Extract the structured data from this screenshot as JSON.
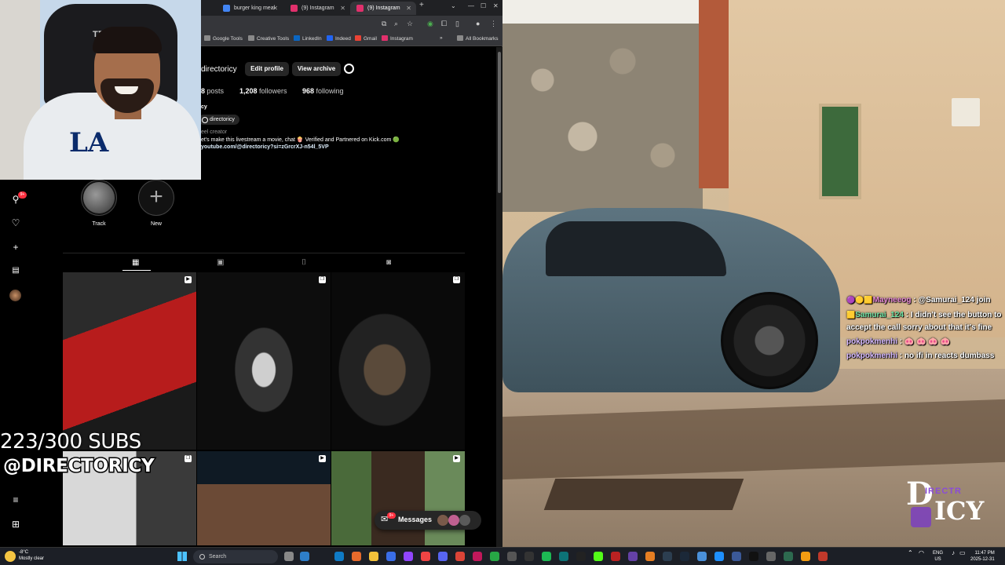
{
  "browser": {
    "tabs": [
      {
        "label": "burger king meal",
        "color": "#4285f4",
        "active": false
      },
      {
        "label": "(9) Instagram",
        "color": "#e1306c",
        "active": false
      },
      {
        "label": "(9) Instagram",
        "color": "#e1306c",
        "active": true
      }
    ],
    "new_tab": "+",
    "bookmarks": [
      {
        "label": "Google Tools",
        "color": "#f4b400"
      },
      {
        "label": "Creative Tools",
        "color": "#f4b400"
      },
      {
        "label": "LinkedIn",
        "color": "#0a66c2"
      },
      {
        "label": "Indeed",
        "color": "#2164f3"
      },
      {
        "label": "Gmail",
        "color": "#ea4335"
      },
      {
        "label": "Instagram",
        "color": "#e1306c"
      }
    ],
    "all_bookmarks": "All Bookmarks"
  },
  "profile": {
    "username": "directoricy",
    "edit_profile": "Edit profile",
    "view_archive": "View archive",
    "posts_count": "8",
    "posts_label": "posts",
    "followers_count": "1,208",
    "followers_label": "followers",
    "following_count": "968",
    "following_label": "following",
    "name_initial": "cy",
    "threads_handle": "directoricy",
    "category": "eel creator",
    "bio_line": "et's make this livestream a movie, chat 🍿 Verified and Partnered on Kick.com 🟢",
    "link": "youtube.com/@directoricy?si=zGrcrXJ-n54l_5VP"
  },
  "highlights": [
    {
      "label": "Track"
    },
    {
      "label": "New"
    }
  ],
  "left_nav": {
    "notif_badge": "9+"
  },
  "messages": {
    "label": "Messages",
    "badge": "9+"
  },
  "overlay": {
    "subs": "223/300 SUBS",
    "handle": "@DIRECTORICY"
  },
  "chat": [
    {
      "user": "Mayneeog",
      "text": ": @Samurai_124 join",
      "cls": "u1"
    },
    {
      "user": "Samurai_124",
      "text": ": I didn't see the button to accept the call sorry about that it's fine",
      "cls": "u2"
    },
    {
      "user": "pokpokmenhi",
      "text": ": 🐽 🐽 🐽 🐽",
      "cls": "u3"
    },
    {
      "user": "pokpokmenhi",
      "text": ": no ifi in reacts dumbass",
      "cls": "u3"
    }
  ],
  "logo": {
    "big": "D",
    "drip": "IRECTR",
    "icy": "ICY"
  },
  "taskbar": {
    "temp": "-8°C",
    "weather": "Mostly clear",
    "search": "Search",
    "lang": "ENG",
    "region": "US",
    "time": "11:47 PM",
    "date": "2025-12-31"
  },
  "webcam": {
    "chair_brand": "T∑∑T"
  },
  "colors": {
    "accent": "#0095f6",
    "badge": "#ff3040",
    "chat_bg": "#000000"
  }
}
